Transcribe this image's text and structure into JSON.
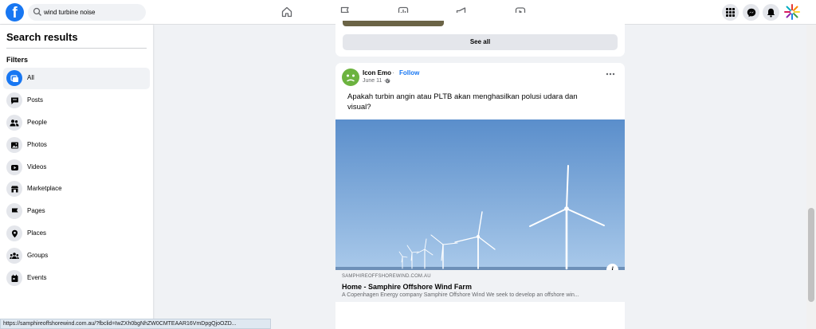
{
  "header": {
    "logo_letter": "f",
    "search_value": "wind turbine noise",
    "nav": [
      "home-icon",
      "flag-icon",
      "chart-icon",
      "megaphone-icon",
      "video-icon"
    ],
    "right": [
      "menu-grid-icon",
      "messenger-icon",
      "notifications-icon",
      "profile-avatar"
    ]
  },
  "sidebar": {
    "title": "Search results",
    "filters_label": "Filters",
    "items": [
      {
        "label": "All",
        "icon": "all-icon",
        "active": true
      },
      {
        "label": "Posts",
        "icon": "posts-icon"
      },
      {
        "label": "People",
        "icon": "people-icon"
      },
      {
        "label": "Photos",
        "icon": "photos-icon"
      },
      {
        "label": "Videos",
        "icon": "videos-icon"
      },
      {
        "label": "Marketplace",
        "icon": "marketplace-icon"
      },
      {
        "label": "Pages",
        "icon": "pages-icon"
      },
      {
        "label": "Places",
        "icon": "places-icon"
      },
      {
        "label": "Groups",
        "icon": "groups-icon"
      },
      {
        "label": "Events",
        "icon": "events-icon"
      }
    ]
  },
  "feed": {
    "see_all": "See all",
    "post": {
      "author": "Icon Emo",
      "separator": "·",
      "follow": "Follow",
      "date": "June 11 ·",
      "text": "Apakah turbin angin atau PLTB akan menghasilkan polusi udara dan visual?",
      "link": {
        "domain": "SAMPHIREOFFSHOREWIND.COM.AU",
        "title": "Home - Samphire Offshore Wind Farm",
        "description": "A Copenhagen Energy company Samphire Offshore Wind We seek to develop an offshore win..."
      },
      "info_glyph": "i"
    }
  },
  "status_url": "https://samphireoffshorewind.com.au/?fbclid=IwZXh0bgNhZW0CMTEAAR16VmDpgQjoOZD...",
  "colors": {
    "brand": "#1877f2",
    "bg": "#f0f2f5",
    "sky_top": "#5a8ecb",
    "sky_bottom": "#a9c9ea"
  }
}
